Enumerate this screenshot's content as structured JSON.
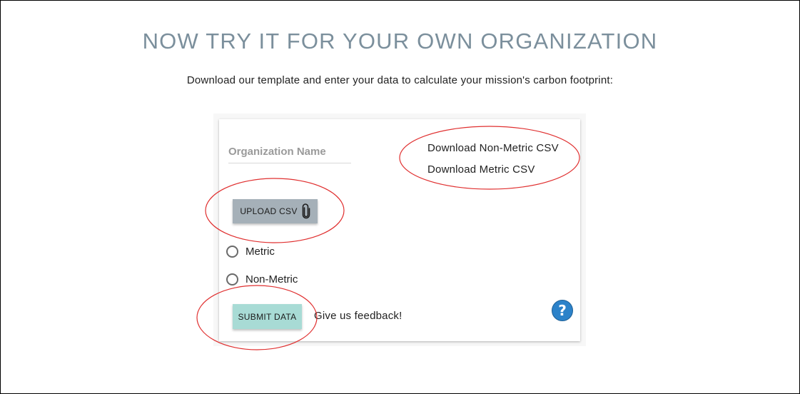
{
  "header": {
    "title": "NOW TRY IT FOR YOUR OWN ORGANIZATION",
    "subtitle": "Download our template and enter your data to calculate your mission's carbon footprint:"
  },
  "form": {
    "org_name_placeholder": "Organization Name",
    "org_name_value": "",
    "download_nonmetric_label": "Download Non-Metric CSV",
    "download_metric_label": "Download Metric CSV",
    "upload_label": "UPLOAD CSV",
    "upload_icon": "paperclip-icon",
    "units_options": [
      {
        "label": "Metric",
        "selected": false
      },
      {
        "label": "Non-Metric",
        "selected": false
      }
    ],
    "submit_label": "SUBMIT DATA",
    "feedback_label": "Give us feedback!",
    "help_glyph": "?",
    "help_icon": "help-icon"
  },
  "colors": {
    "heading": "#7b8f9c",
    "upload_button": "#a5b0b8",
    "submit_button": "#a8dbd5",
    "help_button": "#2c82c9",
    "annotation": "#e03030"
  }
}
